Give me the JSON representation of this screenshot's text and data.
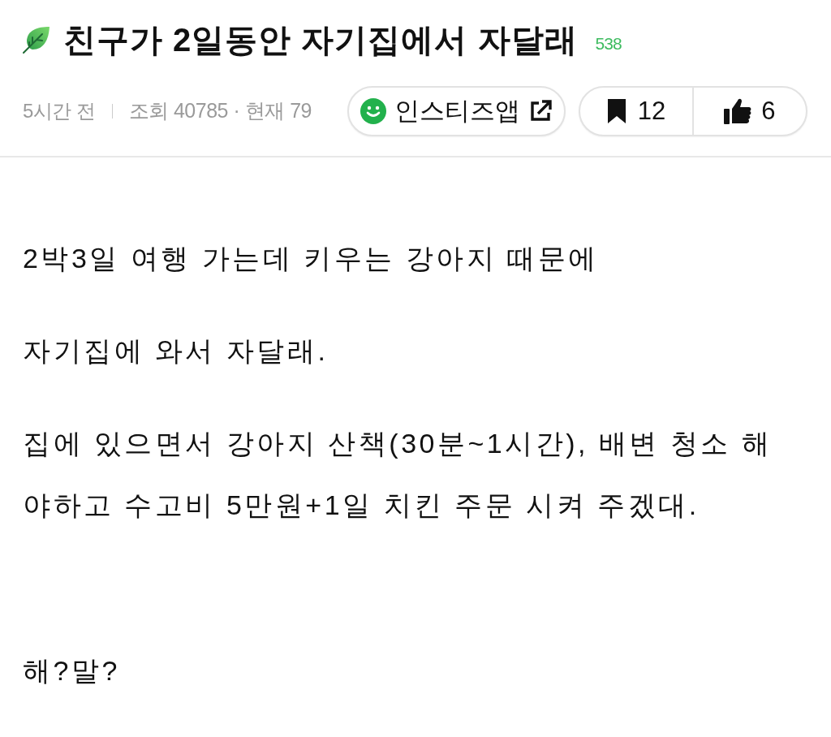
{
  "post": {
    "title": "친구가 2일동안 자기집에서 자달래",
    "comment_count": "538",
    "time": "5시간 전",
    "views": "조회 40785 · 현재 79",
    "app_link": "인스티즈앱",
    "bookmarks": "12",
    "likes": "6"
  },
  "body": {
    "sections": [
      [
        "2박3일 여행 가는데 키우는 강아지 때문에",
        "자기집에 와서 자달래.",
        "집에 있으면서 강아지 산책(30분~1시간), 배변 청소 해야하고 수고비 5만원+1일 치킨 주문 시켜 주겠대."
      ],
      [
        "해?말?"
      ]
    ]
  }
}
